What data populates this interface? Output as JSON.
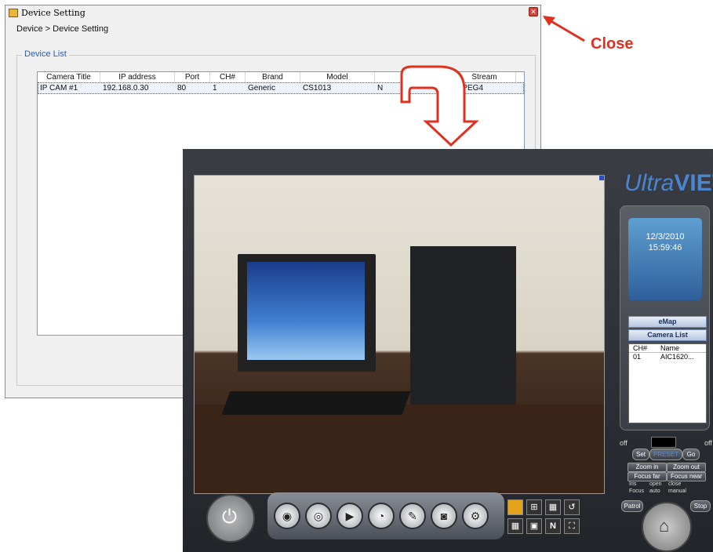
{
  "device_window": {
    "title": "Device Setting",
    "breadcrumb": "Device > Device Setting",
    "group_label": "Device List",
    "columns": [
      "Camera Title",
      "IP address",
      "Port",
      "CH#",
      "Brand",
      "Model",
      "",
      "Stream"
    ],
    "rows": [
      [
        "IP CAM #1",
        "192.168.0.30",
        "80",
        "1",
        "Generic",
        "CS1013",
        "N",
        "MPEG4"
      ]
    ],
    "close_glyph": "✕"
  },
  "annotation": {
    "close_label": "Close",
    "accent_color": "#e03020"
  },
  "ultraview": {
    "brand": {
      "ultra": "Ultra",
      "view": "VIEW"
    },
    "clock": {
      "date": "12/3/2010",
      "time": "15:59:46"
    },
    "emap_button": "eMap",
    "camera_list_button": "Camera List",
    "channel_list": {
      "headers": [
        "CH#",
        "Name"
      ],
      "rows": [
        [
          "01",
          "AIC1620..."
        ]
      ]
    },
    "ptz": {
      "off_left": "off",
      "off_right": "off",
      "set": "Set",
      "preset": "PRESET",
      "go": "Go",
      "zoom_in": "Zoom in",
      "zoom_out": "Zoom out",
      "focus_far": "Focus far",
      "focus_near": "Focus near",
      "iris": "Iris",
      "focus": "Focus",
      "open": "open",
      "auto": "auto",
      "close": "close",
      "manual": "manual",
      "patrol": "Patrol",
      "stop": "Stop"
    }
  }
}
